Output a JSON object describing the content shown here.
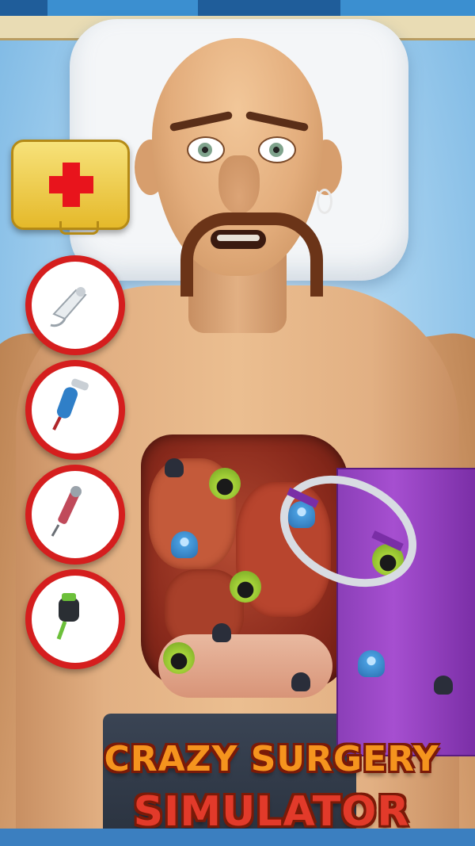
{
  "game": {
    "title_line1": "CRAZY SURGERY",
    "title_line2": "SIMULATOR"
  },
  "toolbar": {
    "items": [
      {
        "icon": "first-aid-kit-icon"
      },
      {
        "icon": "ultrasound-probe-icon"
      },
      {
        "icon": "water-sprayer-icon"
      },
      {
        "icon": "syringe-tool-icon"
      },
      {
        "icon": "suction-tool-icon"
      }
    ]
  },
  "colors": {
    "accent_red": "#d51e1e",
    "title_orange": "#f5941e",
    "title_red": "#e23a2a",
    "panel_purple": "#a64fd0",
    "germ_green": "#a8d43a",
    "germ_blue": "#4a9fe0"
  }
}
